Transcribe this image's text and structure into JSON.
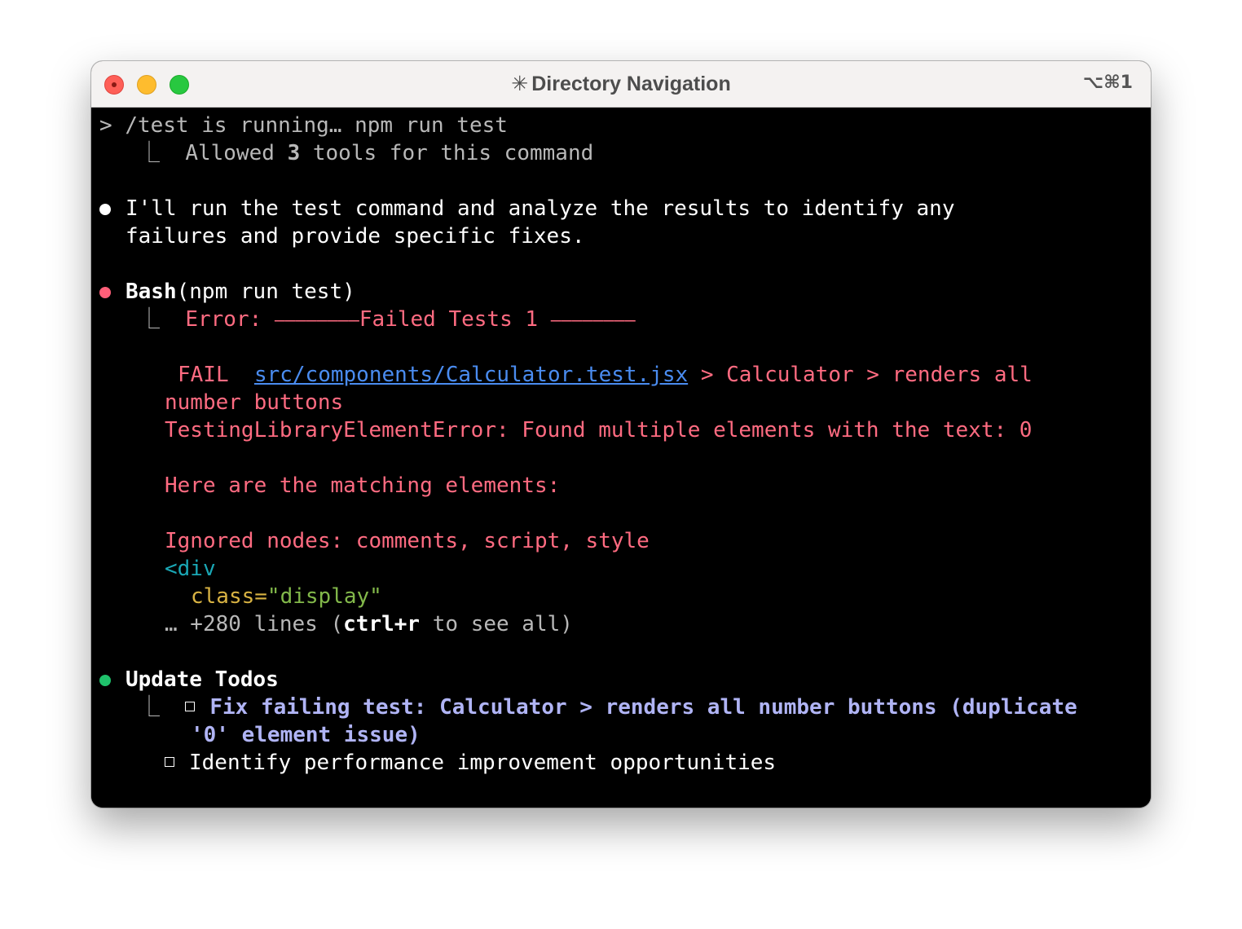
{
  "window": {
    "title": "Directory Navigation",
    "title_glyph": "✳",
    "shortcut": "⌥⌘1"
  },
  "colors": {
    "error": "#ff6b81",
    "link": "#4a8cf0",
    "todo_active": "#b0b4f5",
    "bullet_ok": "#1fc16b",
    "bullet_err": "#ff5f79"
  },
  "terminal": {
    "command": {
      "prompt": ">",
      "text": "/test is running… npm run test"
    },
    "allowed": {
      "prefix": "Allowed",
      "count": "3",
      "suffix": "tools for this command"
    },
    "assistant_message": {
      "line1": "I'll run the test command and analyze the results to identify any",
      "line2": "failures and provide specific fixes."
    },
    "bash": {
      "tool": "Bash",
      "args": "(npm run test)",
      "error_header": "Error: ⎯⎯⎯⎯⎯⎯⎯⎯Failed Tests 1 ⎯⎯⎯⎯⎯⎯⎯⎯",
      "fail_label": "FAIL",
      "fail_file": "src/components/Calculator.test.jsx",
      "fail_rest": "> Calculator > renders all",
      "fail_cont": "number buttons",
      "error_name": "TestingLibraryElementError: Found multiple elements with the text: 0",
      "matching": "Here are the matching elements:",
      "ignored": "Ignored nodes: comments, script, style",
      "div_open": "<div",
      "attr_name": "class=",
      "attr_value": "\"display\"",
      "more_prefix": "… +280 lines (",
      "more_key": "ctrl+r",
      "more_suffix": " to see all)"
    },
    "todos": {
      "title": "Update Todos",
      "items": [
        {
          "line1": "Fix failing test: Calculator > renders all number buttons (duplicate",
          "line2": "'0' element issue)",
          "status": "active"
        },
        {
          "line1": "Identify performance improvement opportunities",
          "status": "pending"
        }
      ]
    }
  }
}
